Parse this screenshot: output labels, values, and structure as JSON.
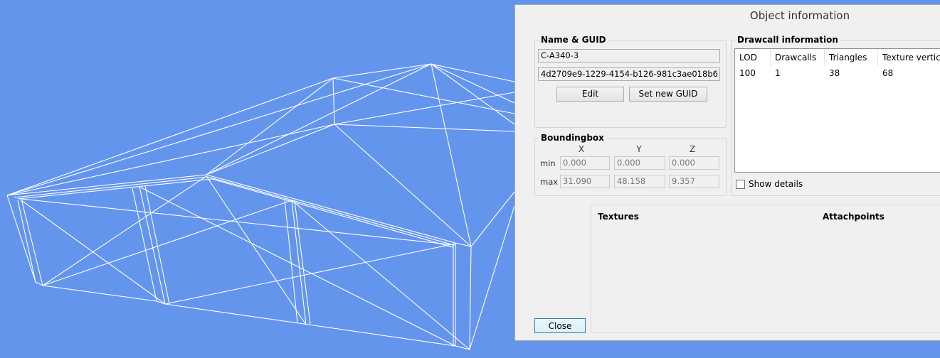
{
  "dialog": {
    "title": "Object information",
    "name_guid": {
      "label": "Name & GUID",
      "name_value": "C-A340-3",
      "guid_value": "4d2709e9-1229-4154-b126-981c3ae018b6",
      "edit_label": "Edit",
      "set_guid_label": "Set new GUID"
    },
    "bounding_box": {
      "label": "Boundingbox",
      "axis_x": "X",
      "axis_y": "Y",
      "axis_z": "Z",
      "min_label": "min",
      "max_label": "max",
      "min_x": "0.000",
      "min_y": "0.000",
      "min_z": "0.000",
      "max_x": "31.090",
      "max_y": "48.158",
      "max_z": "9.357"
    },
    "drawcall": {
      "label": "Drawcall information",
      "columns": [
        "LOD",
        "Drawcalls",
        "Triangles",
        "Texture vertices"
      ],
      "rows": [
        [
          "100",
          "1",
          "38",
          "68"
        ]
      ],
      "show_details_label": "Show details",
      "show_details_checked": false
    },
    "textures_label": "Textures",
    "attachpoints_label": "Attachpoints",
    "close_label": "Close"
  },
  "colors": {
    "viewport_bg": "#6495ed",
    "wireframe": "#ffffff",
    "dialog_bg": "#f0f0f0"
  }
}
